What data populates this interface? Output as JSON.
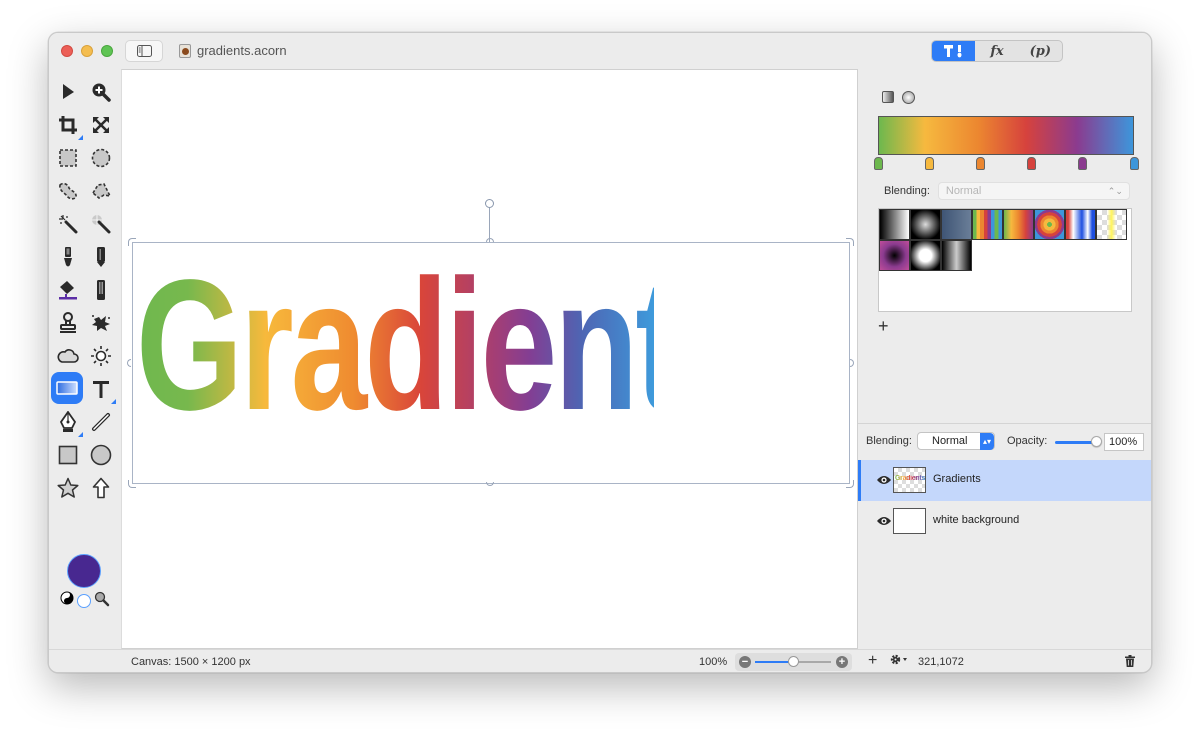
{
  "window": {
    "document_title": "gradients.acorn",
    "toolbar_segments": [
      {
        "id": "tools",
        "label": "",
        "icon": "hammer-brush-icon",
        "active": true
      },
      {
        "id": "filters",
        "label": "fx",
        "active": false
      },
      {
        "id": "properties",
        "label": "(p)",
        "active": false
      }
    ]
  },
  "tools": [
    {
      "name": "select-tool",
      "icon": "arrow-pointer-icon"
    },
    {
      "name": "zoom-tool",
      "icon": "magnifier-plus-icon"
    },
    {
      "name": "crop-tool",
      "icon": "crop-icon"
    },
    {
      "name": "transform-tool",
      "icon": "expand-arrows-icon"
    },
    {
      "name": "rect-select-tool",
      "icon": "dashed-rect-icon"
    },
    {
      "name": "ellipse-select-tool",
      "icon": "dashed-circle-icon"
    },
    {
      "name": "lasso-tool",
      "icon": "lasso-icon"
    },
    {
      "name": "polygon-lasso-tool",
      "icon": "polygon-lasso-icon"
    },
    {
      "name": "magic-wand-tool",
      "icon": "magic-wand-icon"
    },
    {
      "name": "instant-alpha-tool",
      "icon": "sparkle-wand-icon"
    },
    {
      "name": "brush-tool",
      "icon": "brush-icon"
    },
    {
      "name": "pencil-tool",
      "icon": "pencil-icon"
    },
    {
      "name": "paint-bucket-tool",
      "icon": "paint-bucket-icon"
    },
    {
      "name": "eraser-tool",
      "icon": "eraser-icon"
    },
    {
      "name": "clone-tool",
      "icon": "stamp-icon"
    },
    {
      "name": "smudge-tool",
      "icon": "splatter-icon"
    },
    {
      "name": "burn-tool",
      "icon": "cloud-icon"
    },
    {
      "name": "dodge-tool",
      "icon": "sun-icon"
    },
    {
      "name": "gradient-tool",
      "icon": "gradient-rect-icon",
      "active": true
    },
    {
      "name": "text-tool",
      "icon": "text-t-icon"
    },
    {
      "name": "bezier-pen-tool",
      "icon": "pen-nib-icon"
    },
    {
      "name": "line-tool",
      "icon": "line-icon"
    },
    {
      "name": "rectangle-shape-tool",
      "icon": "square-icon"
    },
    {
      "name": "oval-shape-tool",
      "icon": "circle-icon"
    },
    {
      "name": "star-shape-tool",
      "icon": "star-icon"
    },
    {
      "name": "arrow-shape-tool",
      "icon": "arrow-up-icon"
    }
  ],
  "colors": {
    "foreground": "#482890",
    "background": "#ffffff",
    "accent": "#2e7cf6"
  },
  "canvas": {
    "text": "Gradients"
  },
  "gradient_panel": {
    "stops": [
      {
        "color": "#6db84e",
        "position": 0.0
      },
      {
        "color": "#f6b93f",
        "position": 0.2
      },
      {
        "color": "#ec8730",
        "position": 0.4
      },
      {
        "color": "#d6423d",
        "position": 0.6
      },
      {
        "color": "#8b3b8f",
        "position": 0.8
      },
      {
        "color": "#3d96db",
        "position": 1.0
      }
    ],
    "blending_label": "Blending:",
    "blending_value": "Normal",
    "presets": [
      "black-white-linear",
      "radial-white-glow",
      "slate-blue",
      "rainbow-stripes",
      "rainbow-linear",
      "rainbow-radial",
      "white-blue-stripes",
      "yellow-transparent",
      "purple-radial",
      "white-radial-soft",
      "silver-bands"
    ],
    "add_label": "+"
  },
  "layers_panel": {
    "blending_label": "Blending:",
    "blending_value": "Normal",
    "opacity_label": "Opacity:",
    "opacity_value": "100%",
    "opacity_fraction": 1.0,
    "layers": [
      {
        "name": "Gradients",
        "visible": true,
        "selected": true,
        "thumb_text": "Gradients"
      },
      {
        "name": "white background",
        "visible": true,
        "selected": false
      }
    ]
  },
  "status_bar": {
    "canvas_info": "Canvas: 1500 × 1200 px",
    "zoom": "100%",
    "zoom_fraction": 0.5,
    "coordinates": "321,1072",
    "add_label": "+"
  }
}
